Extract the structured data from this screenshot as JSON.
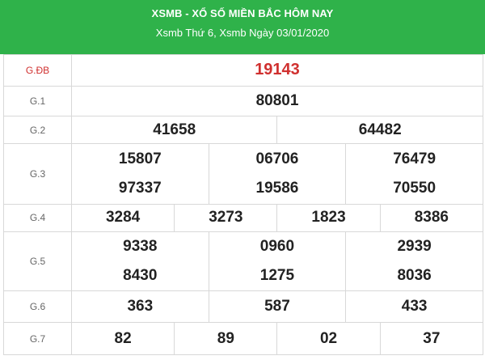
{
  "header": {
    "title": "XSMB - XỔ SỐ MIỀN BẮC HÔM NAY",
    "subtitle": "Xsmb Thứ 6, Xsmb Ngày 03/01/2020"
  },
  "prizes": {
    "gdb": {
      "label": "G.ĐB",
      "numbers": [
        "19143"
      ]
    },
    "g1": {
      "label": "G.1",
      "numbers": [
        "80801"
      ]
    },
    "g2": {
      "label": "G.2",
      "numbers": [
        "41658",
        "64482"
      ]
    },
    "g3": {
      "label": "G.3",
      "numbers": [
        "15807",
        "06706",
        "76479",
        "97337",
        "19586",
        "70550"
      ]
    },
    "g4": {
      "label": "G.4",
      "numbers": [
        "3284",
        "3273",
        "1823",
        "8386"
      ]
    },
    "g5": {
      "label": "G.5",
      "numbers": [
        "9338",
        "0960",
        "2939",
        "8430",
        "1275",
        "8036"
      ]
    },
    "g6": {
      "label": "G.6",
      "numbers": [
        "363",
        "587",
        "433"
      ]
    },
    "g7": {
      "label": "G.7",
      "numbers": [
        "82",
        "89",
        "02",
        "37"
      ]
    }
  },
  "colors": {
    "header_bg": "#2fb24a",
    "special_prize": "#d0302f",
    "border": "#d8d8d8"
  }
}
